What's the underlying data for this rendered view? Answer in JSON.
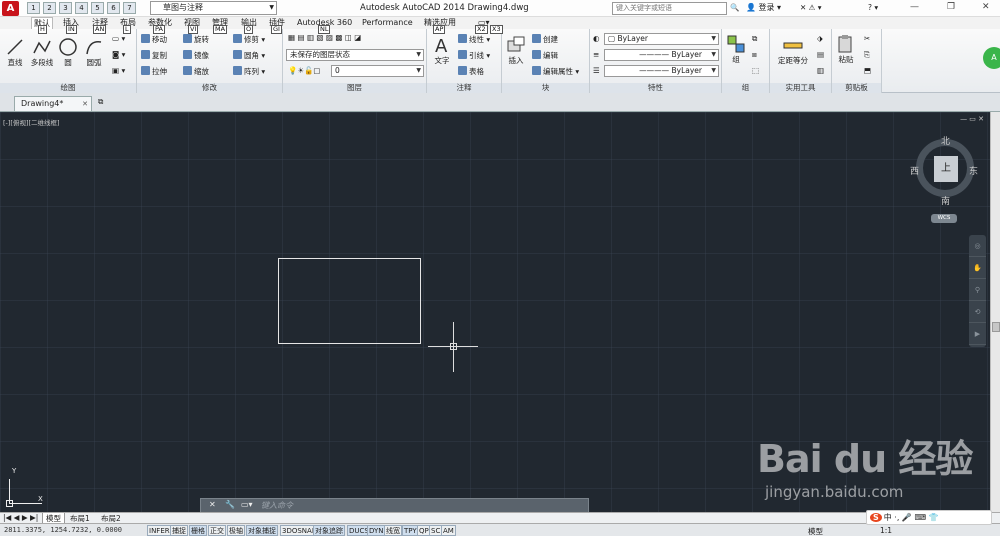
{
  "window": {
    "app_logo": "A",
    "title": "Autodesk AutoCAD 2014    Drawing4.dwg",
    "workspace": "草图与注释",
    "search_placeholder": "键入关键字或短语",
    "login": "登录",
    "help": "?"
  },
  "quick_access_keys": [
    "1",
    "2",
    "3",
    "4",
    "5",
    "6",
    "7"
  ],
  "keytips": {
    "default": "H",
    "insert": "IN",
    "annotate": "AN",
    "layout": "L",
    "parametric": "PA",
    "view": "VI",
    "manage": "MA",
    "output": "O",
    "plugins": "GI",
    "a360": "NL",
    "apps": "AP",
    "x2": "X2",
    "x3": "X3"
  },
  "tabs": [
    "默认",
    "插入",
    "注释",
    "布局",
    "参数化",
    "视图",
    "管理",
    "输出",
    "插件",
    "Autodesk 360",
    "Performance",
    "精选应用"
  ],
  "ribbon": {
    "draw": {
      "title": "绘图",
      "line": "直线",
      "polyline": "多段线",
      "circle": "圆",
      "arc": "圆弧"
    },
    "modify": {
      "title": "修改",
      "move": "移动",
      "rotate": "旋转",
      "trim": "修剪",
      "copy": "复制",
      "mirror": "镜像",
      "fillet": "圆角",
      "stretch": "拉伸",
      "scale": "缩放",
      "array": "阵列"
    },
    "layers": {
      "title": "图层",
      "layer_state": "未保存的图层状态",
      "layer_value": "0"
    },
    "annotation": {
      "title": "注释",
      "text": "文字",
      "dimension": "线性",
      "leader": "引线",
      "table": "表格"
    },
    "block": {
      "title": "块",
      "insert": "插入",
      "create": "创建",
      "edit": "编辑",
      "edit_attr": "编辑属性"
    },
    "properties": {
      "title": "特性",
      "color": "ByLayer",
      "linetype": "ByLayer",
      "lineweight": "ByLayer"
    },
    "groups": {
      "title": "组",
      "group": "组"
    },
    "utilities": {
      "title": "实用工具",
      "measure": "定距等分"
    },
    "clipboard": {
      "title": "剪贴板",
      "paste": "粘贴"
    },
    "a360_btn": "A"
  },
  "file_tab": {
    "name": "Drawing4*"
  },
  "viewport": {
    "label": "[-][俯视][二维线框]",
    "view_face": "上",
    "north": "北",
    "south": "南",
    "east": "东",
    "west": "西",
    "wcs": "WCS"
  },
  "ucs": {
    "y": "Y",
    "x": "X"
  },
  "command": {
    "placeholder": "键入命令"
  },
  "layout_tabs": [
    "模型",
    "布局1",
    "布局2"
  ],
  "status": {
    "coords": "2811.3375, 1254.7232, 0.0000",
    "buttons": [
      "INFER",
      "捕捉",
      "栅格",
      "正交",
      "极轴",
      "对象捕捉",
      "3DOSNAP",
      "对象追踪",
      "DUCS",
      "DYN",
      "线宽",
      "TPY",
      "QP",
      "SC",
      "AM"
    ],
    "model": "模型",
    "scale": "1:1"
  },
  "ime": {
    "logo": "S",
    "text": "中 ·, 🎤 ⌨ 👕"
  },
  "watermark": {
    "brand": "Bai du 经验",
    "url": "jingyan.baidu.com"
  }
}
